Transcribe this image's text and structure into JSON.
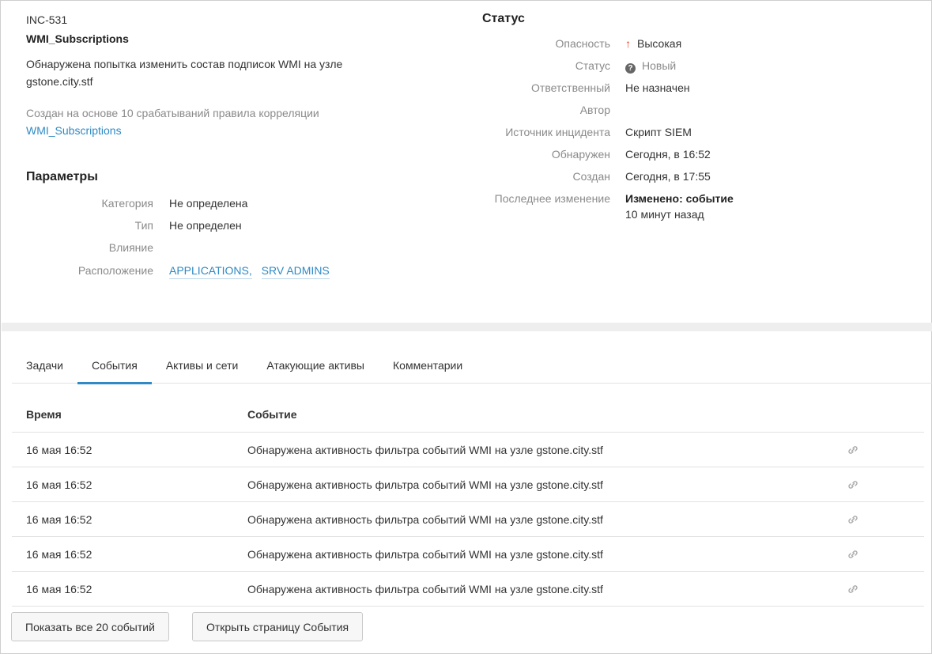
{
  "incident": {
    "id": "INC-531",
    "name": "WMI_Subscriptions",
    "description": "Обнаружена попытка изменить состав подписок WMI на узле gstone.city.stf",
    "origin_text": "Создан на основе 10 срабатываний правила корреляции",
    "origin_rule": "WMI_Subscriptions"
  },
  "params": {
    "title": "Параметры",
    "rows": [
      {
        "label": "Категория",
        "value": "Не определена"
      },
      {
        "label": "Тип",
        "value": "Не определен"
      },
      {
        "label": "Влияние",
        "value": ""
      },
      {
        "label": "Расположение",
        "links": [
          "APPLICATIONS,",
          "SRV ADMINS"
        ]
      }
    ]
  },
  "status": {
    "title": "Статус",
    "severity_label": "Опасность",
    "severity_value": "Высокая",
    "state_label": "Статус",
    "state_value": "Новый",
    "assignee_label": "Ответственный",
    "assignee_value": "Не назначен",
    "author_label": "Автор",
    "author_value": "",
    "source_label": "Источник инцидента",
    "source_value": "Скрипт SIEM",
    "detected_label": "Обнаружен",
    "detected_value": "Сегодня, в 16:52",
    "created_label": "Создан",
    "created_value": "Сегодня, в 17:55",
    "last_change_label": "Последнее изменение",
    "last_change_value": "Изменено: событие",
    "last_change_ago": "10 минут назад",
    "colors": {
      "severity_high": "#e0402a",
      "unassigned": "#e0402a"
    }
  },
  "tabs": [
    {
      "label": "Задачи",
      "active": false
    },
    {
      "label": "События",
      "active": true
    },
    {
      "label": "Активы и сети",
      "active": false
    },
    {
      "label": "Атакующие активы",
      "active": false
    },
    {
      "label": "Комментарии",
      "active": false
    }
  ],
  "events_table": {
    "columns": {
      "time": "Время",
      "event": "Событие"
    },
    "rows": [
      {
        "time": "16 мая 16:52",
        "event": "Обнаружена активность фильтра событий WMI на узле gstone.city.stf",
        "icon": "chain-link-icon"
      },
      {
        "time": "16 мая 16:52",
        "event": "Обнаружена активность фильтра событий WMI на узле gstone.city.stf",
        "icon": "chain-link-icon"
      },
      {
        "time": "16 мая 16:52",
        "event": "Обнаружена активность фильтра событий WMI на узле gstone.city.stf",
        "icon": "chain-link-icon"
      },
      {
        "time": "16 мая 16:52",
        "event": "Обнаружена активность фильтра событий WMI на узле gstone.city.stf",
        "icon": "chain-link-icon"
      },
      {
        "time": "16 мая 16:52",
        "event": "Обнаружена активность фильтра событий WMI на узле gstone.city.stf",
        "icon": "chain-link-icon"
      }
    ]
  },
  "buttons": {
    "show_all": "Показать все 20 событий",
    "open_events": "Открыть страницу События"
  },
  "accent_color": "#2f8ac4"
}
